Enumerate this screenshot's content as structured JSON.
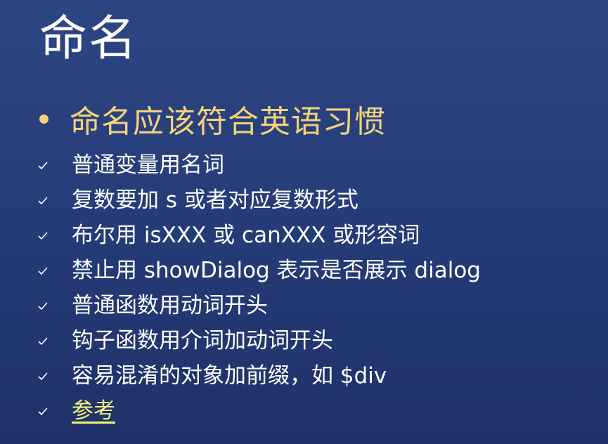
{
  "slide": {
    "title": "命名",
    "main_bullet": "命名应该符合英语习惯",
    "items": [
      "普通变量用名词",
      "复数要加 s 或者对应复数形式",
      "布尔用 isXXX 或 canXXX 或形容词",
      "禁止用 showDialog 表示是否展示 dialog",
      "普通函数用动词开头",
      "钩子函数用介词加动词开头",
      "容易混淆的对象加前缀，如 $div"
    ],
    "link_label": "参考",
    "colors": {
      "background": "#263d7a",
      "accent": "#f5d27a",
      "link": "#f2f27a",
      "text": "#ffffff"
    },
    "icons": {
      "main_bullet": "bullet-dot-icon",
      "sub_bullet": "checkmark-icon"
    }
  }
}
